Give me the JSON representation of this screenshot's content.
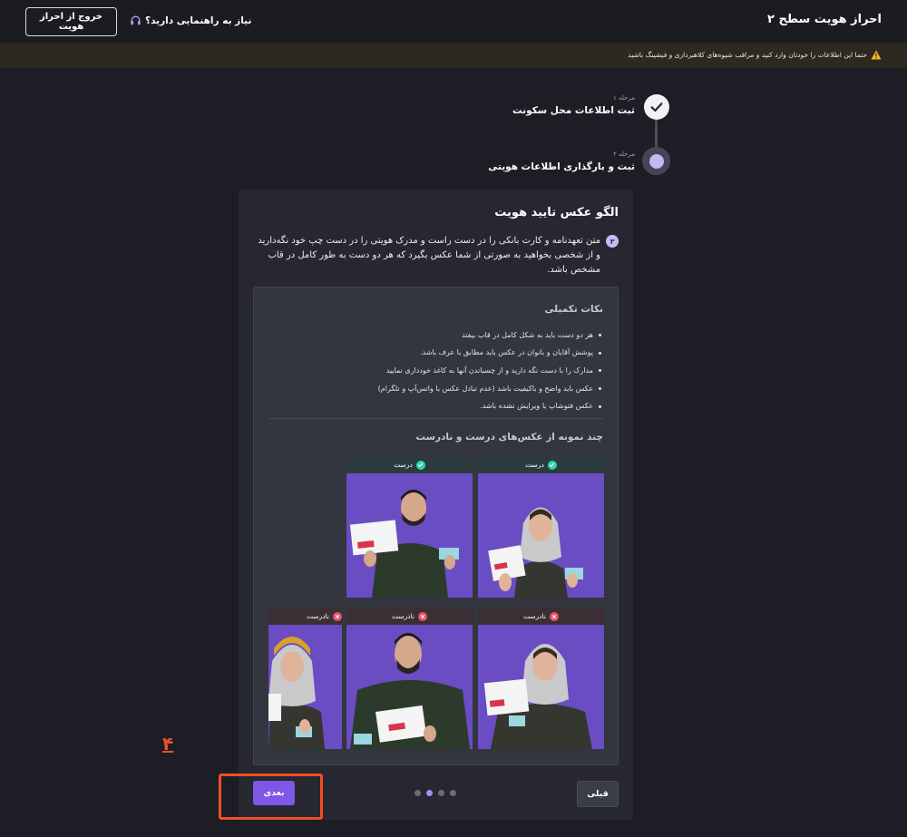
{
  "header": {
    "title": "احراز هویت سطح ۲",
    "exit_button": "خروج از احراز هویت",
    "help_link": "نیاز به راهنمایی دارید؟",
    "help_icon": "headset-icon"
  },
  "warning": {
    "icon": "warning-icon",
    "text": "حتما این اطلاعات را خودتان وارد کنید و مراقب شیوه‌های کلاهبرداری و فیشینگ باشید"
  },
  "stepper": {
    "steps": [
      {
        "caption": "مرحله ۱",
        "label": "ثبت اطلاعات محل سکونت",
        "status": "done"
      },
      {
        "caption": "مرحله ۲",
        "label": "ثبت و بارگذاری اطلاعات هویتی",
        "status": "active"
      }
    ]
  },
  "card": {
    "title": "الگو عکس تایید هویت",
    "instruction_number": "۳",
    "instruction_text": "متن تعهدنامه و کارت بانکی را در دست راست و مدرک هویتی را در دست چپ خود نگه‌دارید و از شخصی بخواهید به صورتی از شما عکس بگیرد که هر دو دست به طور کامل در قاب مشخص باشد.",
    "tips_title": "نکات تکمیلی",
    "tips": [
      "هر دو دست باید به شکل کامل در قاب بیفتد",
      "پوشش آقایان و بانوان در عکس باید مطابق با عرف باشد.",
      "مدارک را با دست نگه دارید و از چسباندن آنها به کاغذ خودداری نمایید",
      "عکس باید واضح و باکیفیت باشد (عدم تبادل عکس با واتس‌آپ و تلگرام)",
      "عکس فتوشاپ یا ویرایش نشده باشد."
    ],
    "samples_title": "چند نمونه از عکس‌های درست و نادرست",
    "samples": [
      {
        "label": "درست",
        "status": "correct",
        "subject": "woman"
      },
      {
        "label": "درست",
        "status": "correct",
        "subject": "man"
      },
      {
        "label": "نادرست",
        "status": "incorrect",
        "subject": "woman"
      },
      {
        "label": "نادرست",
        "status": "incorrect",
        "subject": "man"
      },
      {
        "label": "نادرست",
        "status": "incorrect",
        "subject": "woman-yellow-scarf"
      }
    ]
  },
  "navigation": {
    "prev_label": "قبلی",
    "next_label": "بعدی",
    "page_count": 4,
    "active_page": 2
  },
  "annotation": {
    "number": "۴",
    "color": "#f04f28"
  },
  "colors": {
    "accent": "#7e57e6",
    "correct": "#2fd3b7",
    "incorrect": "#e3546f",
    "photo_bg": "#6c4fc6"
  }
}
